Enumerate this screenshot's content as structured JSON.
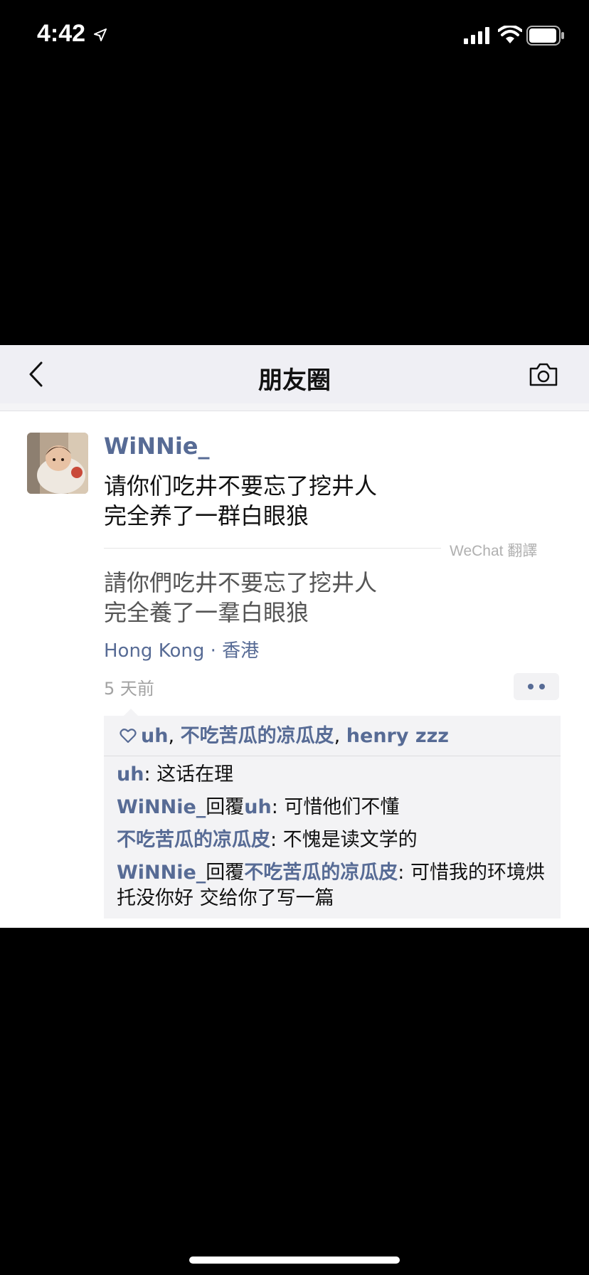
{
  "status_bar": {
    "time": "4:42"
  },
  "header": {
    "title": "朋友圈"
  },
  "post": {
    "author": "WiNNie_",
    "text_line1": "请你们吃井不要忘了挖井人",
    "text_line2": "完全养了一群白眼狼",
    "translate_label": "WeChat 翻譯",
    "translated_line1": "請你們吃井不要忘了挖井人",
    "translated_line2": "完全養了一羣白眼狼",
    "location": "Hong Kong · 香港",
    "timestamp": "5 天前"
  },
  "likes": {
    "user1": "uh",
    "sep1": ", ",
    "user2": "不吃苦瓜的凉瓜皮",
    "sep2": ", ",
    "user3": "henry zzz"
  },
  "comments": [
    {
      "name": "uh",
      "text": ": 这话在理"
    },
    {
      "name": "WiNNie_",
      "reply_word": "回覆",
      "target": "uh",
      "text": ": 可惜他们不懂"
    },
    {
      "name": "不吃苦瓜的凉瓜皮",
      "text": ": 不愧是读文学的"
    },
    {
      "name": "WiNNie_",
      "reply_word": "回覆",
      "target": "不吃苦瓜的凉瓜皮",
      "text": ": 可惜我的环境烘托没你好 交给你了写一篇"
    }
  ],
  "colors": {
    "link": "#576b95",
    "header_bg": "#efeff4",
    "comment_bg": "#f3f3f5"
  },
  "icons": [
    "location-arrow-icon",
    "signal-icon",
    "wifi-icon",
    "battery-icon",
    "back-icon",
    "camera-icon",
    "heart-icon",
    "more-dots-icon"
  ]
}
